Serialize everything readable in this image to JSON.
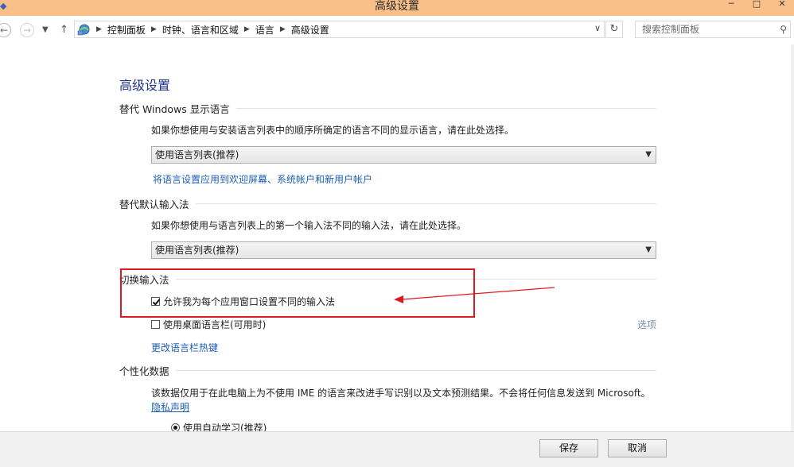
{
  "window": {
    "title": "高级设置",
    "minimize_icon": "minimize-icon",
    "maximize_icon": "maximize-icon",
    "close_icon": "close-icon"
  },
  "nav": {
    "breadcrumbs": [
      "控制面板",
      "时钟、语言和区域",
      "语言",
      "高级设置"
    ],
    "search_placeholder": "搜索控制面板"
  },
  "page": {
    "heading": "高级设置"
  },
  "display_language": {
    "section": "替代 Windows 显示语言",
    "description": "如果你想使用与安装语言列表中的顺序所确定的语言不同的显示语言，请在此处选择。",
    "selected": "使用语言列表(推荐)",
    "apply_link": "将语言设置应用到欢迎屏幕、系统帐户和新用户帐户"
  },
  "input_method": {
    "section": "替代默认输入法",
    "description": "如果你想使用与语言列表上的第一个输入法不同的输入法，请在此处选择。",
    "selected": "使用语言列表(推荐)"
  },
  "switch_input": {
    "section": "切换输入法",
    "per_app": {
      "label": "允许我为每个应用窗口设置不同的输入法",
      "checked": true
    },
    "desktop_bar": {
      "label": "使用桌面语言栏(可用时)",
      "checked": false
    },
    "options_link": "选项",
    "hotkey_link": "更改语言栏热键"
  },
  "personalization": {
    "section": "个性化数据",
    "description": "该数据仅用于在此电脑上为不使用 IME 的语言来改进手写识别以及文本预测结果。不会将任何信息发送到 Microsoft。",
    "privacy_link": "隐私声明",
    "radio_label": "使用自动学习(推荐)"
  },
  "footer": {
    "save": "保存",
    "cancel": "取消"
  },
  "colors": {
    "titlebar": "#f9c08a",
    "heading": "#1e3287",
    "link": "#1b5fb5",
    "annotation": "#e0181f"
  }
}
